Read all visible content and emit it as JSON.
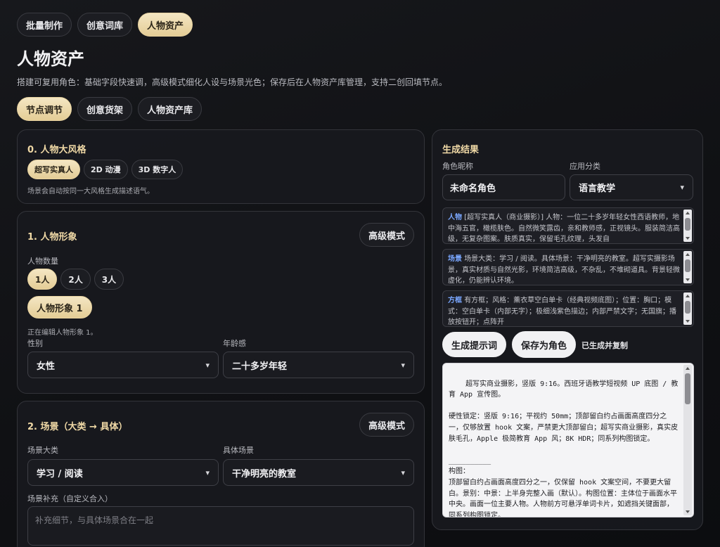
{
  "topnav": [
    "批量制作",
    "创意词库",
    "人物资产"
  ],
  "page": {
    "title": "人物资产",
    "subtitle": "搭建可复用角色：基础字段快速调，高级模式细化人设与场景光色；保存后在人物资产库管理，支持二创回填节点。"
  },
  "subnav": [
    "节点调节",
    "创意货架",
    "人物资产库"
  ],
  "style_card": {
    "title": "0. 人物大风格",
    "options": [
      "超写实真人",
      "2D 动漫",
      "3D 数字人"
    ],
    "hint": "场景会自动按同一大风格生成描述语气。"
  },
  "figure_card": {
    "title": "1. 人物形象",
    "adv_label": "高级模式",
    "count_label": "人物数量",
    "counts": [
      "1人",
      "2人",
      "3人"
    ],
    "figure_tab": "人物形象 1",
    "editing_hint": "正在编辑人物形象 1。",
    "gender_label": "性别",
    "gender_value": "女性",
    "age_label": "年龄感",
    "age_value": "二十多岁年轻"
  },
  "scene_card": {
    "title": "2. 场景（大类 → 具体）",
    "adv_label": "高级模式",
    "category_label": "场景大类",
    "category_value": "学习 / 阅读",
    "specific_label": "具体场景",
    "specific_value": "干净明亮的教室",
    "extra_label": "场景补充（自定义合入）",
    "extra_placeholder": "补充细节，与具体场景合在一起"
  },
  "result": {
    "title": "生成结果",
    "name_label": "角色昵称",
    "name_value": "未命名角色",
    "category_label": "应用分类",
    "category_value": "语言教学",
    "blocks": [
      {
        "tag": "人物",
        "text": "[超写实真人（商业摄影）] 人物：一位二十多岁年轻女性西语教师，地中海五官，橄榄肤色。自然微笑露齿，亲和教师感，正视镜头。服装简洁高级，无复杂图案。肤质真实，保留毛孔纹理，头发自"
      },
      {
        "tag": "场景",
        "text": "场景大类：学习 / 阅读。具体场景：干净明亮的教室。超写实摄影场景，真实材质与自然光影，环境简洁高级，不杂乱，不堆砌道具。背景轻微虚化，仍能辨认环境。"
      },
      {
        "tag": "方框",
        "text": "有方框；风格：薰衣草空白单卡（经典视频底图）；位置：胸口；模式：空白单卡（内部无字）；极细浅紫色描边；内部严禁文字；无国旗；播放按钮开；点阵开"
      }
    ],
    "generate_btn": "生成提示词",
    "save_btn": "保存为角色",
    "status": "已生成并复制",
    "output": "超写实商业摄影，竖版 9:16。西班牙语教学短视频 UP 底图 / 教育 App 宣传图。\n\n硬性锁定：竖版 9:16；平视约 50mm；顶部留白约占画面高度四分之一，仅够放置 hook 文案，严禁更大顶部留白；超写实商业摄影，真实皮肤毛孔，Apple 极简教育 App 风；8K HDR；同系列构图锁定。\n\n__________\n构图：\n顶部留白约占画面高度四分之一，仅保留 hook 文案空间，不要更大留白。景别：中景：上半身完整入画（默认）。构图位置：主体位于画面水平中央。画面一位主要人物。人物前方可悬浮单词卡片，如遮挡关键面部，同系列构图锁定。"
  },
  "colors": {
    "accent_gold": "#f0d9a6",
    "tag_blue": "#7aa7ff"
  }
}
